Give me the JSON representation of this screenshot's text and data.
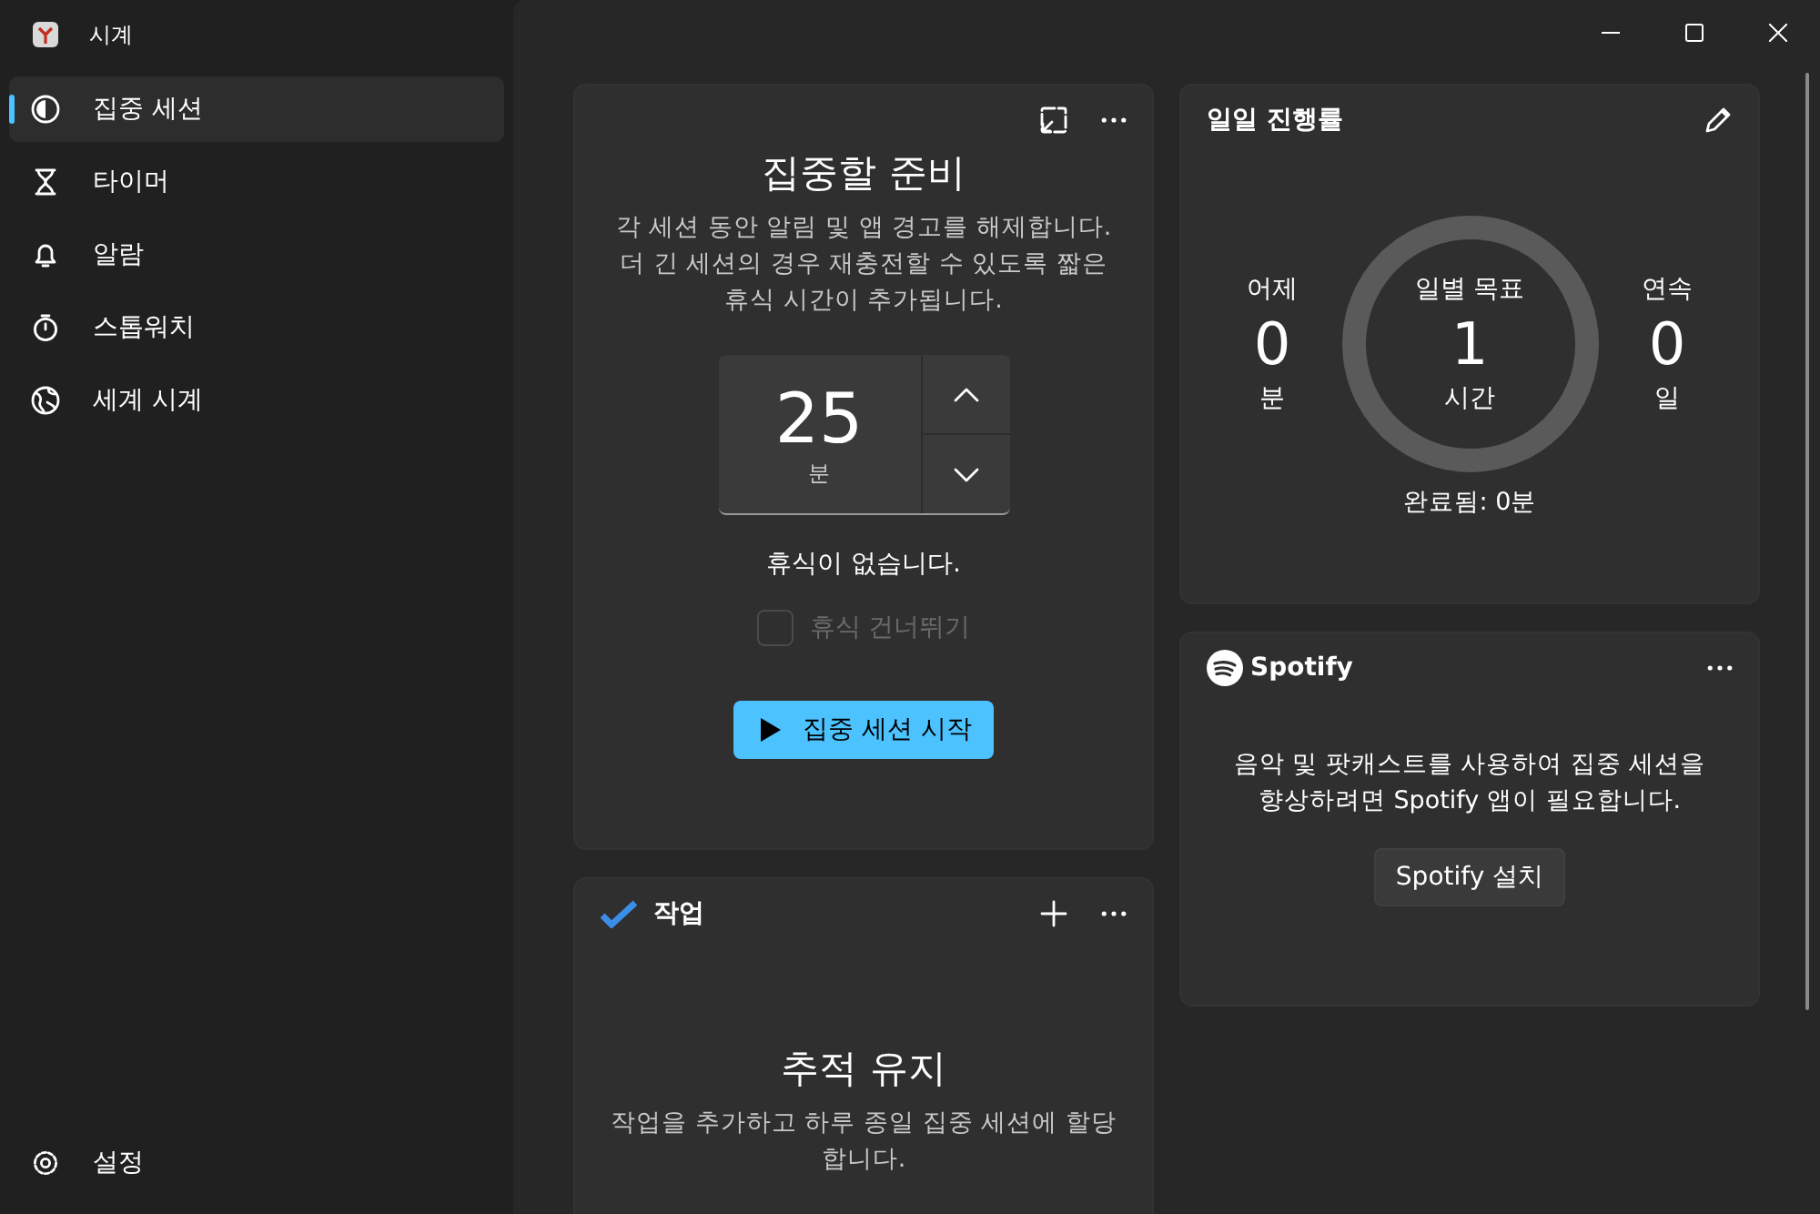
{
  "window": {
    "title": "시계"
  },
  "sidebar": {
    "items": [
      {
        "label": "집중 세션",
        "selected": true
      },
      {
        "label": "타이머",
        "selected": false
      },
      {
        "label": "알람",
        "selected": false
      },
      {
        "label": "스톱워치",
        "selected": false
      },
      {
        "label": "세계 시계",
        "selected": false
      }
    ],
    "footer": {
      "label": "설정",
      "selected": false
    }
  },
  "focus_card": {
    "title": "집중할 준비",
    "description": "각 세션 동안 알림 및 앱 경고를 해제합니다. 더 긴 세션의 경우 재충전할 수 있도록 짧은 휴식 시간이 추가됩니다.",
    "duration": {
      "value": "25",
      "unit": "분"
    },
    "break_note": "휴식이 없습니다.",
    "skip_breaks": {
      "label": "휴식 건너뛰기",
      "checked": false,
      "disabled": true
    },
    "start_button": "집중 세션 시작"
  },
  "tasks_card": {
    "title": "작업",
    "heading": "추적 유지",
    "description": "작업을 추가하고 하루 종일 집중 세션에 할당합니다."
  },
  "progress_card": {
    "title": "일일 진행률",
    "yesterday": {
      "label": "어제",
      "value": "0",
      "unit": "분"
    },
    "goal": {
      "label": "일별 목표",
      "value": "1",
      "unit": "시간"
    },
    "streak": {
      "label": "연속",
      "value": "0",
      "unit": "일"
    },
    "completed": "완료됨: 0분"
  },
  "spotify_card": {
    "brand": "Spotify",
    "message": "음악 및 팟캐스트를 사용하여 집중 세션을 향상하려면 Spotify 앱이 필요합니다.",
    "button": "Spotify 설치"
  }
}
